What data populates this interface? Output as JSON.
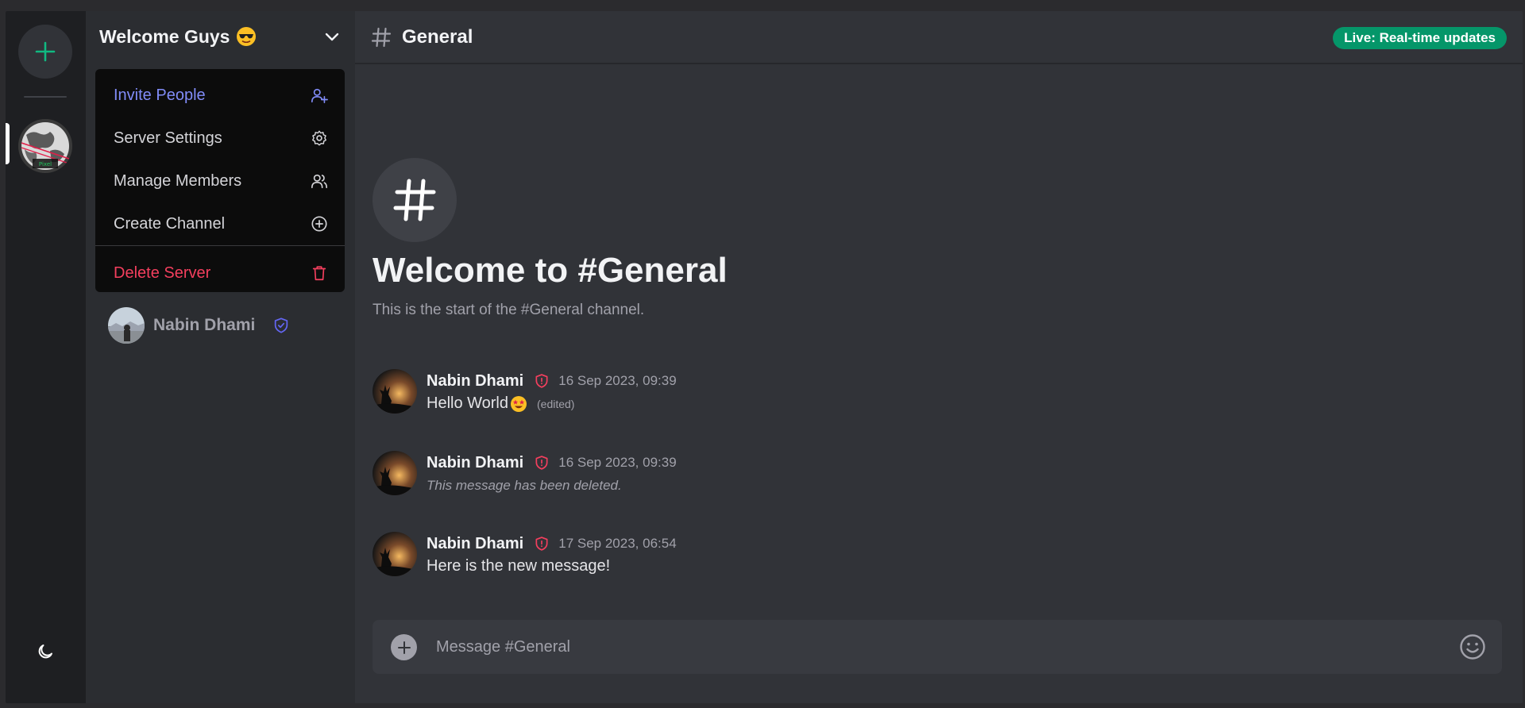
{
  "server": {
    "name": "Welcome Guys",
    "name_emoji": "sunglasses-emoji",
    "menu": [
      {
        "label": "Invite People",
        "icon": "user-plus-icon"
      },
      {
        "label": "Server Settings",
        "icon": "gear-icon"
      },
      {
        "label": "Manage Members",
        "icon": "users-icon"
      },
      {
        "label": "Create Channel",
        "icon": "plus-circle-icon"
      },
      {
        "label": "Delete Server",
        "icon": "trash-icon"
      }
    ],
    "members": [
      {
        "name": "Nabin Dhami",
        "badge": "shield-check-icon"
      }
    ]
  },
  "rail": {
    "server_icon_text": "Pixel"
  },
  "channel": {
    "name": "General",
    "live_badge": "Live: Real-time updates",
    "welcome_title": "Welcome to #General",
    "welcome_subtitle": "This is the start of the #General channel."
  },
  "messages": [
    {
      "author": "Nabin Dhami",
      "time": "16 Sep 2023, 09:39",
      "text": "Hello World",
      "edited": "(edited)",
      "deleted": false
    },
    {
      "author": "Nabin Dhami",
      "time": "16 Sep 2023, 09:39",
      "text": "This message has been deleted.",
      "deleted": true
    },
    {
      "author": "Nabin Dhami",
      "time": "17 Sep 2023, 06:54",
      "text": "Here is the new message!",
      "deleted": false
    }
  ],
  "composer": {
    "placeholder": "Message #General"
  },
  "colors": {
    "accent_green": "#059669",
    "invite": "#818cf8",
    "danger": "#f43f5e",
    "rail_bg": "#1e1f22",
    "sidebar_bg": "#2b2d31",
    "main_bg": "#313338"
  }
}
